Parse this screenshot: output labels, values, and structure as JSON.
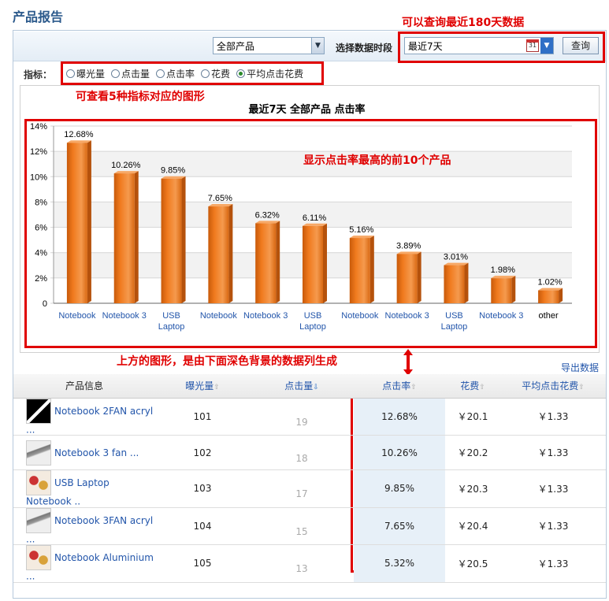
{
  "page": {
    "title": "产品报告"
  },
  "toolbar": {
    "product_select": "全部产品",
    "period_label": "选择数据时段",
    "period_value": "最近7天",
    "calendar_day": "31",
    "query_label": "查询"
  },
  "metrics": {
    "label": "指标：",
    "options": [
      {
        "label": "曝光量",
        "selected": false
      },
      {
        "label": "点击量",
        "selected": false
      },
      {
        "label": "点击率",
        "selected": false
      },
      {
        "label": "花费",
        "selected": false
      },
      {
        "label": "平均点击花费",
        "selected": true
      }
    ]
  },
  "annotations": {
    "top_right": "可以查询最近180天数据",
    "metrics": "可查看5种指标对应的图形",
    "chart": "显示点击率最高的前10个产品",
    "link": "上方的图形，是由下面深色背景的数据列生成"
  },
  "chart_data": {
    "type": "bar",
    "title": "最近7天 全部产品 点击率",
    "categories": [
      "Notebook",
      "Notebook 3",
      "USB Laptop",
      "Notebook",
      "Notebook 3",
      "USB Laptop",
      "Notebook",
      "Notebook 3",
      "USB Laptop",
      "Notebook 3",
      "other"
    ],
    "values": [
      12.68,
      10.26,
      9.85,
      7.65,
      6.32,
      6.11,
      5.16,
      3.89,
      3.01,
      1.98,
      1.02
    ],
    "value_labels": [
      "12.68%",
      "10.26%",
      "9.85%",
      "7.65%",
      "6.32%",
      "6.11%",
      "5.16%",
      "3.89%",
      "3.01%",
      "1.98%",
      "1.02%"
    ],
    "yticks": [
      "0",
      "2%",
      "4%",
      "6%",
      "8%",
      "10%",
      "12%",
      "14%"
    ],
    "ylim": [
      0,
      14
    ],
    "grid": true,
    "bar_color": "#f07a1e"
  },
  "export_label": "导出数据",
  "table": {
    "headers": [
      "产品信息",
      "曝光量",
      "点击量",
      "点击率",
      "花费",
      "平均点击花费"
    ],
    "rows": [
      {
        "name": "Notebook 2FAN acryl ...",
        "impressions": "101",
        "clicks": "19",
        "ctr": "12.68%",
        "cost": "￥20.1",
        "cpc": "￥1.33"
      },
      {
        "name": "Notebook 3 fan ...",
        "impressions": "102",
        "clicks": "18",
        "ctr": "10.26%",
        "cost": "￥20.2",
        "cpc": "￥1.33"
      },
      {
        "name": "USB Laptop Notebook ..",
        "impressions": "103",
        "clicks": "17",
        "ctr": "9.85%",
        "cost": "￥20.3",
        "cpc": "￥1.33"
      },
      {
        "name": "Notebook 3FAN acryl ...",
        "impressions": "104",
        "clicks": "15",
        "ctr": "7.65%",
        "cost": "￥20.4",
        "cpc": "￥1.33"
      },
      {
        "name": "Notebook Aluminium ...",
        "impressions": "105",
        "clicks": "13",
        "ctr": "5.32%",
        "cost": "￥20.5",
        "cpc": "￥1.33"
      }
    ]
  }
}
